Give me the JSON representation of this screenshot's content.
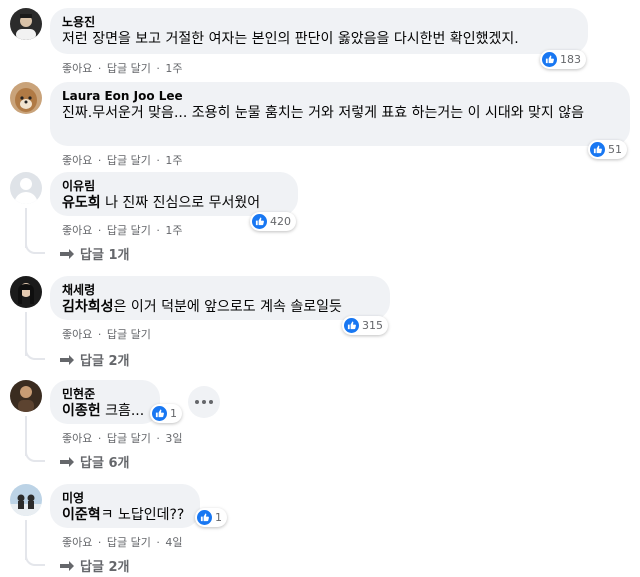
{
  "actions": {
    "like": "좋아요",
    "reply": "답글 달기",
    "separator": "·"
  },
  "comments": [
    {
      "author": "노용진",
      "text": "저런 장면을 보고 거절한 여자는 본인의 판단이 옳았음을 다시한번 확인했겠지.",
      "time": "1주",
      "likes": "183"
    },
    {
      "author": "Laura Eon Joo Lee",
      "text": "진짜.무서운거 맞음... 조용히 눈물 훔치는 거와 저렇게 표효 하는거는 이 시대와 맞지 않음",
      "time": "1주",
      "likes": "51"
    },
    {
      "author": "이유림",
      "mention": "유도희",
      "text": " 나 진짜 진심으로 무서웠어",
      "time": "1주",
      "likes": "420",
      "replies": "답글 1개"
    },
    {
      "author": "채세령",
      "mention": "김차희성",
      "text": "은 이거 덕분에 앞으로도 계속 솔로일듯",
      "likes": "315",
      "replies": "답글 2개"
    },
    {
      "author": "민현준",
      "mention": "이종헌",
      "text": " 크흠...",
      "time": "3일",
      "likes": "1",
      "replies": "답글 6개"
    },
    {
      "author": "미영",
      "mention": "이준혁",
      "text": "ㅋ 노답인데??",
      "time": "4일",
      "likes": "1",
      "replies": "답글 2개"
    }
  ],
  "icons": {
    "like": "thumbs-up-icon",
    "more": "more-options-icon",
    "reply_arrow": "reply-arrow-icon"
  },
  "colors": {
    "bubble": "#f0f2f5",
    "like_blue": "#1877f2",
    "secondary_text": "#65676b"
  }
}
